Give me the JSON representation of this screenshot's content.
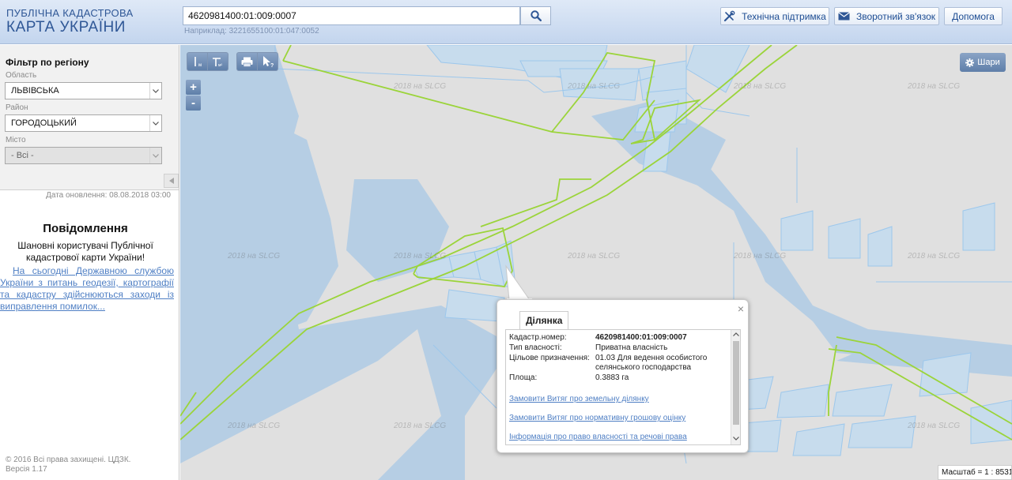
{
  "header": {
    "logo_line1": "ПУБЛІЧНА КАДАСТРОВА",
    "logo_line2": "КАРТА УКРАЇНИ",
    "search_value": "4620981400:01:009:0007",
    "search_example": "Наприклад: 3221655100:01:047:0052",
    "support_label": "Технічна підтримка",
    "feedback_label": "Зворотний зв'язок",
    "help_label": "Допомога"
  },
  "sidebar": {
    "filter_title": "Фільтр по регіону",
    "region_label": "Область",
    "region_value": "ЛЬВІВСЬКА",
    "district_label": "Район",
    "district_value": "ГОРОДОЦЬКИЙ",
    "city_label": "Місто",
    "city_value": "- Всі -",
    "update_date": "Дата оновлення: 08.08.2018 03:00",
    "notice_title": "Повідомлення",
    "notice_greeting": "Шановні користувачі Публічної кадастрової карти України!",
    "notice_link": "На сьогодні Державною службою України з питань геодезії, картографії та кадастру здійснюються заходи із виправлення помилок...",
    "copyright": "© 2016 Всі права захищені. ЦДЗК. Версія 1.17"
  },
  "map": {
    "tools": [
      "measure-length-icon",
      "measure-area-icon",
      "print-icon",
      "identify-icon"
    ],
    "zoom_in": "+",
    "zoom_out": "-",
    "layers_label": "Шари",
    "watermark": "2018 на SLCG",
    "scale": "Масштаб = 1 : 8531"
  },
  "popup": {
    "tab": "Ділянка",
    "close": "×",
    "rows": [
      {
        "key": "Кадастр.номер:",
        "value": "4620981400:01:009:0007"
      },
      {
        "key": "Тип власності:",
        "value": "Приватна власність"
      },
      {
        "key": "Цільове призначення:",
        "value": "01.03 Для ведення особистого селянського господарства"
      },
      {
        "key": "Площа:",
        "value": "0.3883 га"
      }
    ],
    "links": [
      "Замовити Витяг про земельну ділянку",
      "Замовити Витяг про нормативну грошову оцінку",
      "Інформація про право власності та речові права"
    ]
  },
  "colors": {
    "header_text": "#2f5796",
    "map_water": "#b6cee4",
    "map_land": "#e0e0e0",
    "boundary_green": "#9bd43a",
    "parcel_blue": "#9cc7ec",
    "link_blue": "#4f7fc4"
  }
}
